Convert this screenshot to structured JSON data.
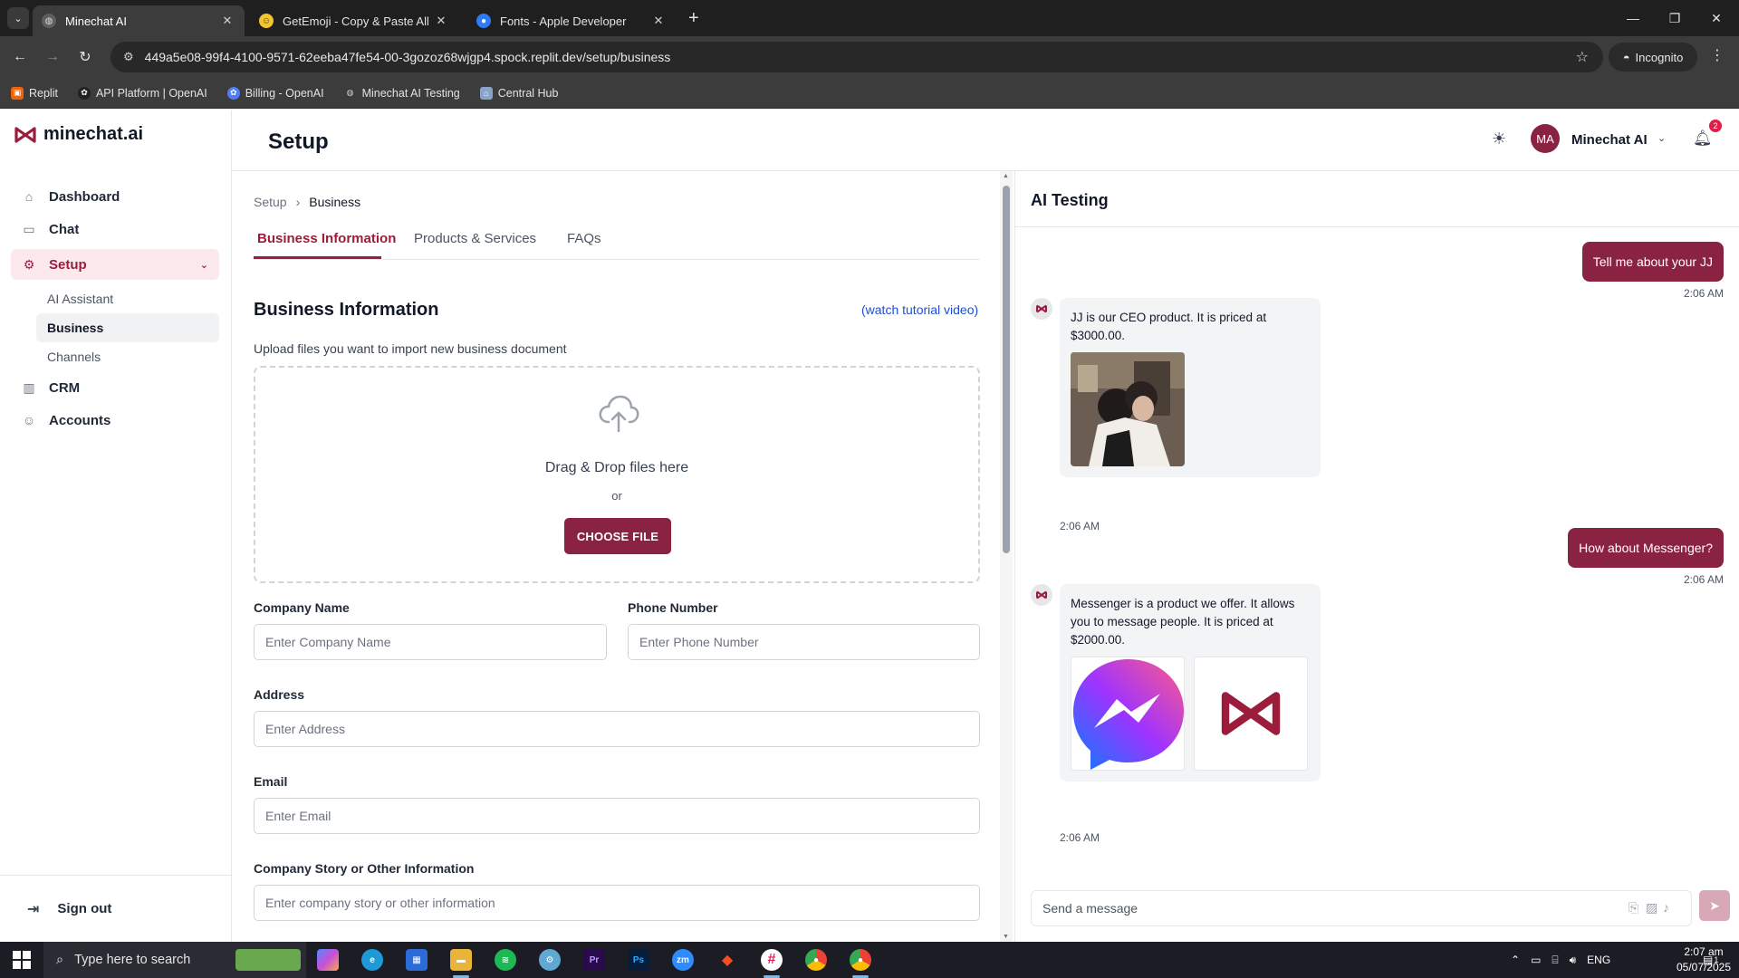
{
  "browser": {
    "tabs": [
      {
        "title": "Minechat AI",
        "active": true
      },
      {
        "title": "GetEmoji - Copy & Paste All Em",
        "active": false
      },
      {
        "title": "Fonts - Apple Developer",
        "active": false
      }
    ],
    "url": "449a5e08-99f4-4100-9571-62eeba47fe54-00-3gozoz68wjgp4.spock.replit.dev/setup/business",
    "incognito_label": "Incognito",
    "bookmarks": [
      {
        "label": "Replit",
        "icon": "replit-icon",
        "color": "#f26207"
      },
      {
        "label": "API Platform | OpenAI",
        "icon": "openai-icon",
        "color": "#222222"
      },
      {
        "label": "Billing - OpenAI",
        "icon": "openai-billing-icon",
        "color": "#4f7df9"
      },
      {
        "label": "Minechat AI Testing",
        "icon": "globe-icon",
        "color": "#cccccc"
      },
      {
        "label": "Central Hub",
        "icon": "hub-icon",
        "color": "#8aa3c9"
      }
    ]
  },
  "app": {
    "brand": "minechat.ai",
    "brand_color": "#9b1d3b",
    "page_title": "Setup",
    "user": {
      "initials": "MA",
      "name": "Minechat AI"
    },
    "notification_count": "2",
    "nav": [
      {
        "label": "Dashboard",
        "icon": "home-icon"
      },
      {
        "label": "Chat",
        "icon": "chat-bubble-icon"
      },
      {
        "label": "Setup",
        "icon": "gear-icon",
        "active": true
      },
      {
        "label": "CRM",
        "icon": "bar-chart-icon"
      },
      {
        "label": "Accounts",
        "icon": "users-icon"
      }
    ],
    "setup_sub": [
      {
        "label": "AI Assistant"
      },
      {
        "label": "Business",
        "active": true
      },
      {
        "label": "Channels"
      }
    ],
    "sign_out": "Sign out"
  },
  "business": {
    "breadcrumb": [
      "Setup",
      "Business"
    ],
    "tabs": [
      "Business Information",
      "Products & Services",
      "FAQs"
    ],
    "section_title": "Business Information",
    "tutorial_link": "(watch tutorial video)",
    "upload_note": "Upload files you want to import new business document",
    "dropzone": {
      "text": "Drag & Drop files here",
      "or": "or",
      "button": "CHOOSE FILE"
    },
    "fields": {
      "company_name": {
        "label": "Company Name",
        "placeholder": "Enter Company Name"
      },
      "phone": {
        "label": "Phone Number",
        "placeholder": "Enter Phone Number"
      },
      "address": {
        "label": "Address",
        "placeholder": "Enter Address"
      },
      "email": {
        "label": "Email",
        "placeholder": "Enter Email"
      },
      "story": {
        "label": "Company Story or Other Information",
        "placeholder": "Enter company story or other information"
      }
    }
  },
  "chat": {
    "title": "AI Testing",
    "messages": [
      {
        "from": "user",
        "text": "Tell me about your JJ",
        "time": "2:06 AM"
      },
      {
        "from": "bot",
        "text": "JJ is our CEO product. It is priced at $3000.00.",
        "time": "2:06 AM",
        "images": [
          "photo"
        ]
      },
      {
        "from": "user",
        "text": "How about Messenger?",
        "time": "2:06 AM"
      },
      {
        "from": "bot",
        "text": "Messenger is a product we offer. It allows you to message people. It is priced at $2000.00.",
        "time": "2:06 AM",
        "images": [
          "messenger-logo",
          "minechat-logo"
        ]
      }
    ],
    "composer_placeholder": "Send a message"
  },
  "taskbar": {
    "search_placeholder": "Type here to search",
    "lang": "ENG",
    "time": "2:07 am",
    "date": "05/07/2025",
    "notif_count": "1"
  }
}
